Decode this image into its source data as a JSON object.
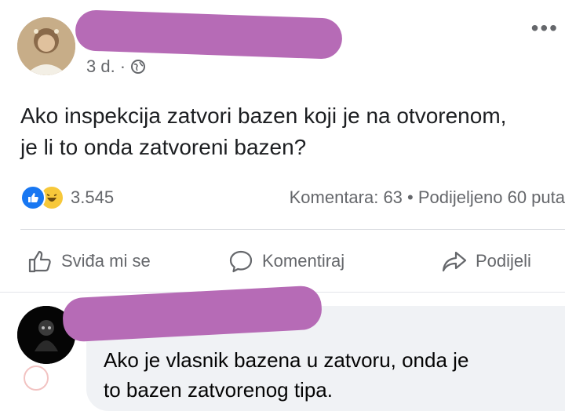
{
  "post": {
    "meta_time": "3 d. ·",
    "more_glyph": "•••",
    "text_line1": "Ako inspekcija zatvori bazen koji je na otvorenom,",
    "text_line2": "je li to onda zatvoreni bazen?",
    "reaction_count": "3.545",
    "stats_right": "Komentara: 63 • Podijeljeno 60 puta",
    "actions": {
      "like": "Sviđa mi se",
      "comment": "Komentiraj",
      "share": "Podijeli"
    }
  },
  "comment": {
    "line1": "Ako je vlasnik bazena u zatvoru, onda je",
    "line2": "to bazen zatvorenog tipa."
  },
  "colors": {
    "accent": "#1877f2",
    "redaction": "#b66bb6",
    "text_muted": "#65676b"
  }
}
